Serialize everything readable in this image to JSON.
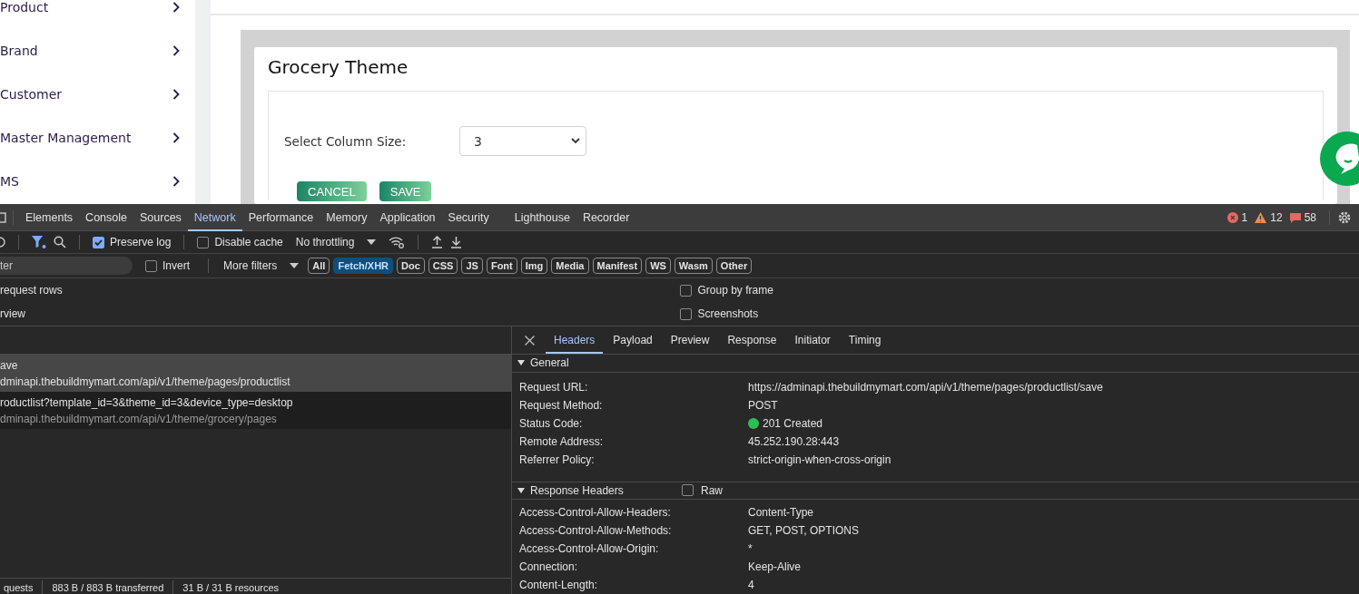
{
  "sidebar": {
    "items": [
      {
        "label": "Product"
      },
      {
        "label": "Brand"
      },
      {
        "label": "Customer"
      },
      {
        "label": "Master Management"
      },
      {
        "label": "MS"
      }
    ]
  },
  "page": {
    "title": "Grocery Theme",
    "field_label": "Select Column Size:",
    "select_value": "3",
    "buttons": [
      "CANCEL",
      "SAVE"
    ]
  },
  "devtools": {
    "tabs": [
      {
        "label": "Elements",
        "selected": false
      },
      {
        "label": "Console",
        "selected": false
      },
      {
        "label": "Sources",
        "selected": false
      },
      {
        "label": "Network",
        "selected": true
      },
      {
        "label": "Performance",
        "selected": false
      },
      {
        "label": "Memory",
        "selected": false
      },
      {
        "label": "Application",
        "selected": false
      },
      {
        "label": "Security",
        "selected": false
      },
      {
        "label": "Lighthouse",
        "selected": false
      },
      {
        "label": "Recorder",
        "selected": false
      }
    ],
    "counts": {
      "errors": "1",
      "warnings": "12",
      "issues": "58"
    },
    "toolbar": {
      "checks": [
        {
          "label": "Preserve log",
          "checked": true
        },
        {
          "label": "Disable cache",
          "checked": false
        }
      ],
      "throttling": "No throttling"
    },
    "filter": {
      "placeholder": "ter",
      "invert": {
        "label": "Invert",
        "checked": false
      },
      "more_filters": "More filters",
      "types": [
        {
          "label": "All",
          "selected": false
        },
        {
          "label": "Fetch/XHR",
          "selected": true
        },
        {
          "label": "Doc",
          "selected": false
        },
        {
          "label": "CSS",
          "selected": false
        },
        {
          "label": "JS",
          "selected": false
        },
        {
          "label": "Font",
          "selected": false
        },
        {
          "label": "Img",
          "selected": false
        },
        {
          "label": "Media",
          "selected": false
        },
        {
          "label": "Manifest",
          "selected": false
        },
        {
          "label": "WS",
          "selected": false
        },
        {
          "label": "Wasm",
          "selected": false
        },
        {
          "label": "Other",
          "selected": false
        }
      ]
    },
    "options_left": [
      "request rows",
      "rview"
    ],
    "options_right": [
      {
        "label": "Group by frame",
        "checked": false
      },
      {
        "label": "Screenshots",
        "checked": false
      }
    ],
    "requests": [
      {
        "name": "ave",
        "url": "dminapi.thebuildmymart.com/api/v1/theme/pages/productlist",
        "selected": true
      },
      {
        "name": "roductlist?template_id=3&theme_id=3&device_type=desktop",
        "url": "dminapi.thebuildmymart.com/api/v1/theme/grocery/pages",
        "selected": false
      }
    ],
    "status_bar": [
      "quests",
      "883 B / 883 B transferred",
      "31 B / 31 B resources"
    ],
    "detail_tabs": [
      {
        "label": "Headers",
        "selected": true
      },
      {
        "label": "Payload",
        "selected": false
      },
      {
        "label": "Preview",
        "selected": false
      },
      {
        "label": "Response",
        "selected": false
      },
      {
        "label": "Initiator",
        "selected": false
      },
      {
        "label": "Timing",
        "selected": false
      }
    ],
    "general": {
      "title": "General",
      "rows": [
        {
          "name": "Request URL:",
          "value": "https://adminapi.thebuildmymart.com/api/v1/theme/pages/productlist/save"
        },
        {
          "name": "Request Method:",
          "value": "POST"
        },
        {
          "name": "Status Code:",
          "value": "201 Created",
          "color": "#2dbd55"
        },
        {
          "name": "Remote Address:",
          "value": "45.252.190.28:443"
        },
        {
          "name": "Referrer Policy:",
          "value": "strict-origin-when-cross-origin"
        }
      ]
    },
    "response_headers": {
      "title": "Response Headers",
      "raw": {
        "label": "Raw",
        "checked": false
      },
      "rows": [
        {
          "name": "Access-Control-Allow-Headers:",
          "value": "Content-Type"
        },
        {
          "name": "Access-Control-Allow-Methods:",
          "value": "GET, POST, OPTIONS"
        },
        {
          "name": "Access-Control-Allow-Origin:",
          "value": "*"
        },
        {
          "name": "Connection:",
          "value": "Keep-Alive"
        },
        {
          "name": "Content-Length:",
          "value": "4"
        }
      ]
    }
  }
}
